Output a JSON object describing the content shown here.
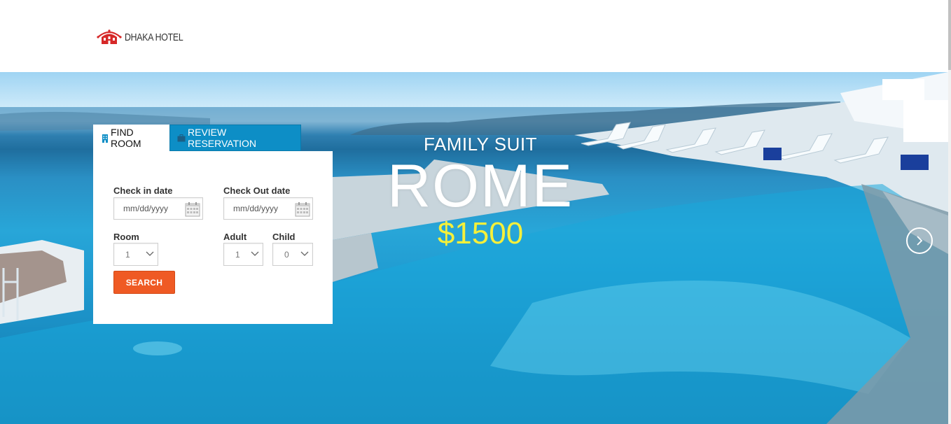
{
  "header": {
    "logo_text": "DHAKA HOTEL"
  },
  "booking": {
    "tabs": [
      {
        "label": "FIND ROOM",
        "icon": "building-icon",
        "active": true
      },
      {
        "label": "REVIEW RESERVATION",
        "icon": "briefcase-icon",
        "active": false
      }
    ],
    "check_in_label": "Check in date",
    "check_in_placeholder": "mm/dd/yyyy",
    "check_out_label": "Check Out date",
    "check_out_placeholder": "mm/dd/yyyy",
    "room_label": "Room",
    "room_value": "1",
    "adult_label": "Adult",
    "adult_value": "1",
    "child_label": "Child",
    "child_value": "0",
    "search_label": "SEARCH"
  },
  "slide": {
    "subtitle": "FAMILY SUIT",
    "title": "ROME",
    "price": "$1500",
    "next_icon": "chevron-right-icon"
  },
  "colors": {
    "accent_blue": "#0d8ec6",
    "search_orange": "#ef5a24",
    "price_yellow": "#f6f03a"
  }
}
